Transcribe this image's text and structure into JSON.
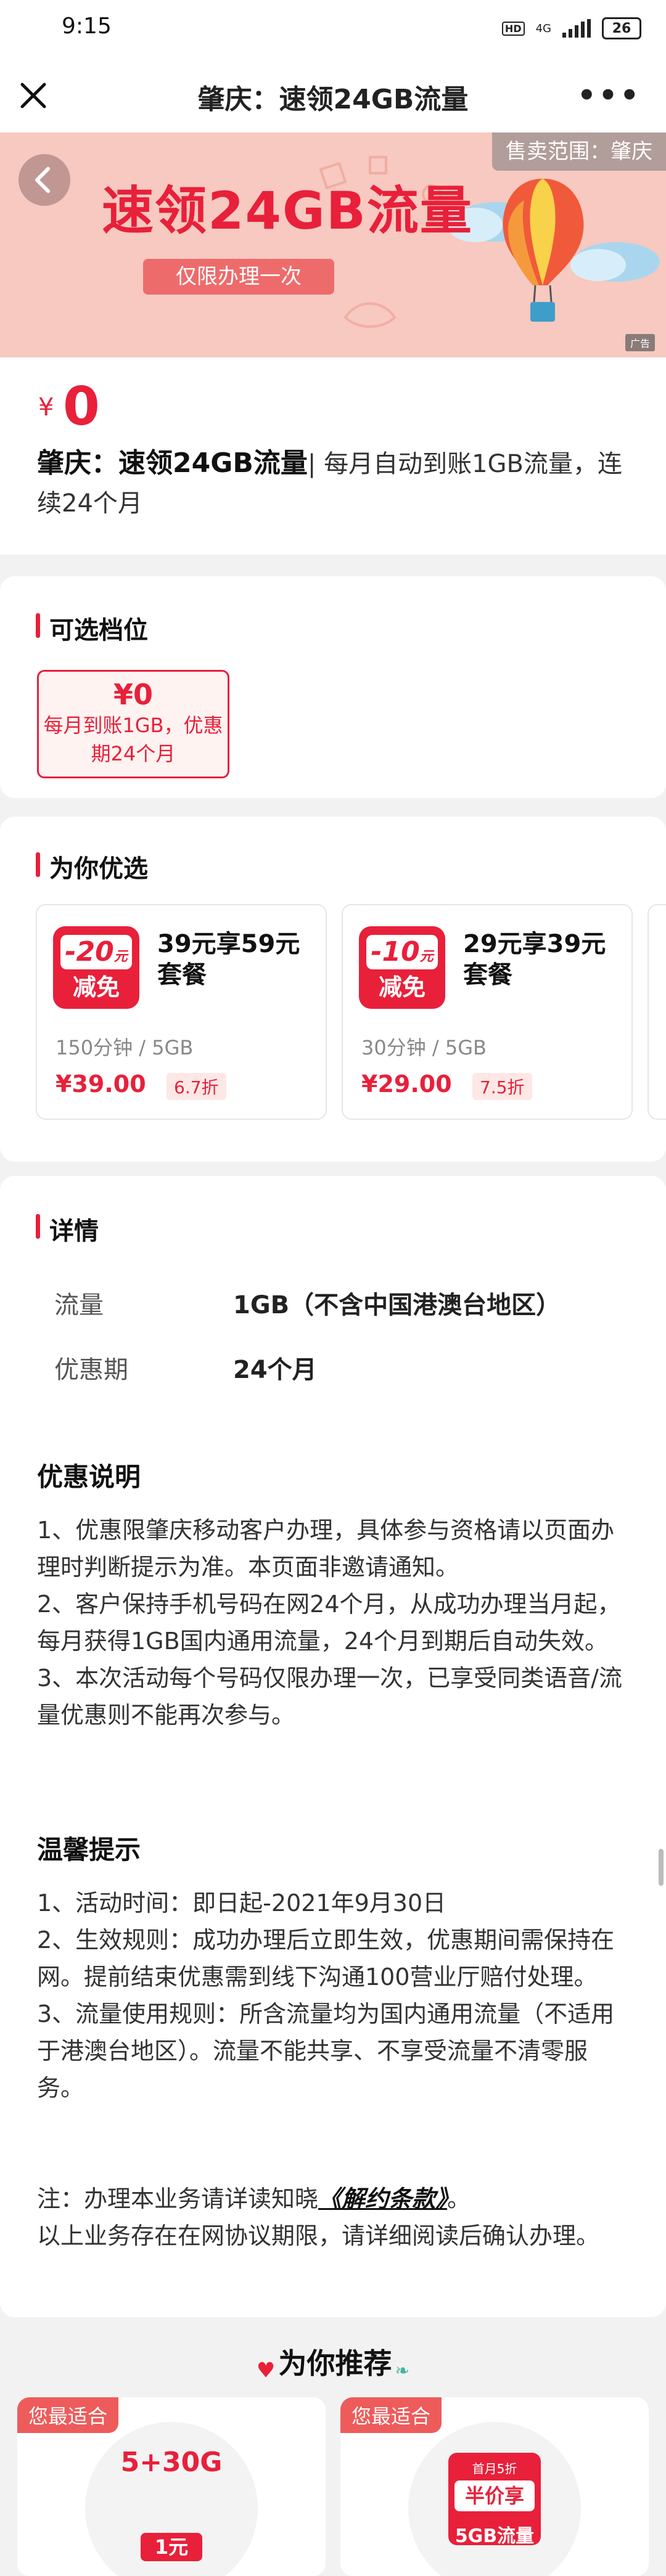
{
  "status_bar": {
    "time": "9:15",
    "network": "4G",
    "battery": "26"
  },
  "header": {
    "title": "肇庆：速领24GB流量"
  },
  "banner": {
    "title": "速领24GB流量",
    "pill": "仅限办理一次",
    "sale_region": "售卖范围：肇庆",
    "ad_tag": "广告"
  },
  "product": {
    "price_symbol": "¥",
    "price": "0",
    "name": "肇庆：速领24GB流量",
    "separator": "|",
    "desc": " 每月自动到账1GB流量，连续24个月"
  },
  "tiers": {
    "title": "可选档位",
    "items": [
      {
        "price": "¥0",
        "desc": "每月到账1GB，优惠期24个月"
      }
    ]
  },
  "recommend": {
    "title": "为你优选",
    "packages": [
      {
        "badge_amount": "-20",
        "badge_unit": "元",
        "badge_label": "减免",
        "name": "39元享59元套餐",
        "spec": "150分钟 / 5GB",
        "price": "¥39.00",
        "discount": "6.7折"
      },
      {
        "badge_amount": "-10",
        "badge_unit": "元",
        "badge_label": "减免",
        "name": "29元享39元套餐",
        "spec": "30分钟 / 5GB",
        "price": "¥29.00",
        "discount": "7.5折"
      }
    ]
  },
  "details": {
    "title": "详情",
    "rows": [
      {
        "label": "流量",
        "value": "1GB（不含中国港澳台地区）"
      },
      {
        "label": "优惠期",
        "value": "24个月"
      }
    ],
    "offer_title": "优惠说明",
    "offer_items": [
      "1、优惠限肇庆移动客户办理，具体参与资格请以页面办理时判断提示为准。本页面非邀请通知。",
      "2、客户保持手机号码在网24个月，从成功办理当月起，每月获得1GB国内通用流量，24个月到期后自动失效。",
      "3、本次活动每个号码仅限办理一次，已享受同类语音/流量优惠则不能再次参与。"
    ],
    "tips_title": "温馨提示",
    "tips_items": [
      "1、活动时间：即日起-2021年9月30日",
      "2、生效规则：成功办理后立即生效，优惠期间需保持在网。提前结束优惠需到线下沟通100营业厅赔付处理。",
      "3、流量使用规则：所含流量均为国内通用流量（不适用于港澳台地区）。流量不能共享、不享受流量不清零服务。"
    ],
    "note_prefix": "注：办理本业务请详读知晓",
    "note_link": "《解约条款》",
    "note_suffix": "。",
    "note_line2": "以上业务存在在网协议期限，请详细阅读后确认办理。"
  },
  "bottom": {
    "title": "为你推荐",
    "cards": [
      {
        "tag": "您最适合",
        "headline": "5+30G",
        "sub": "1元"
      },
      {
        "tag": "您最适合",
        "ribbon": "首月5折",
        "headline": "半价享",
        "sub": "5GB流量"
      }
    ]
  },
  "colors": {
    "accent": "#e8203a",
    "banner_bg": "#f7c9c0"
  }
}
